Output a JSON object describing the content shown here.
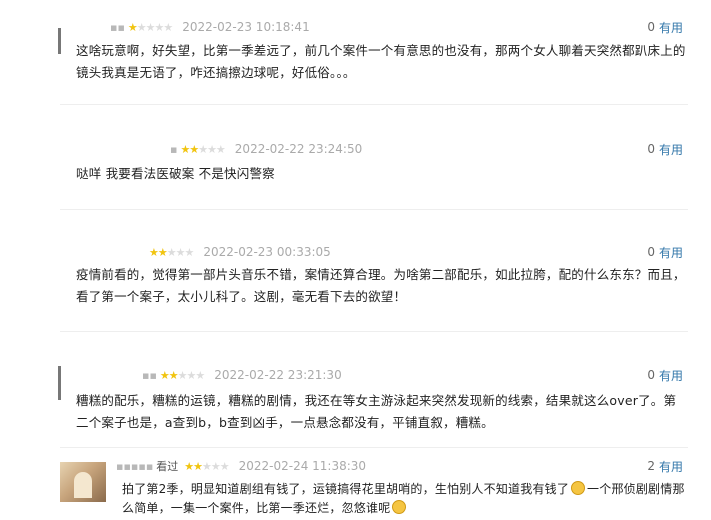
{
  "reviews": [
    {
      "stars": 1,
      "time": "2022-02-23 10:18:41",
      "user": "",
      "useful_count": "0",
      "useful_label": "有用",
      "text": "这啥玩意啊，好失望，比第一季差远了，前几个案件一个有意思的也没有，那两个女人聊着天突然都趴床上的镜头我真是无语了，咋还搞擦边球呢，好低俗。。。"
    },
    {
      "stars": 2,
      "time": "2022-02-22 23:24:50",
      "user": "",
      "useful_count": "0",
      "useful_label": "有用",
      "text": "哒咩 我要看法医破案 不是快闪警察"
    },
    {
      "stars": 2,
      "time": "2022-02-23 00:33:05",
      "user": "",
      "useful_count": "0",
      "useful_label": "有用",
      "text": "疫情前看的，觉得第一部片头音乐不错，案情还算合理。为啥第二部配乐，如此拉胯，配的什么东东？而且，看了第一个案子，太小儿科了。这剧，毫无看下去的欲望！"
    },
    {
      "stars": 2,
      "time": "2022-02-22 23:21:30",
      "user": "",
      "useful_count": "0",
      "useful_label": "有用",
      "text": "糟糕的配乐，糟糕的运镜，糟糕的剧情，我还在等女主游泳起来突然发现新的线索，结果就这么over了。第二个案子也是，a查到b，b查到凶手，一点悬念都没有，平铺直叙，糟糕。"
    },
    {
      "stars": 2,
      "time": "2022-02-24 11:38:30",
      "user": "看过",
      "useful_count": "2",
      "useful_label": "有用",
      "text_part1": "拍了第2季，明显知道剧组有钱了，运镜搞得花里胡哨的，生怕别人不知道我有钱了",
      "text_part2": "一个邢侦剧剧情那么简单，一集一个案件，比第一季还烂，忽悠谁呢"
    }
  ]
}
